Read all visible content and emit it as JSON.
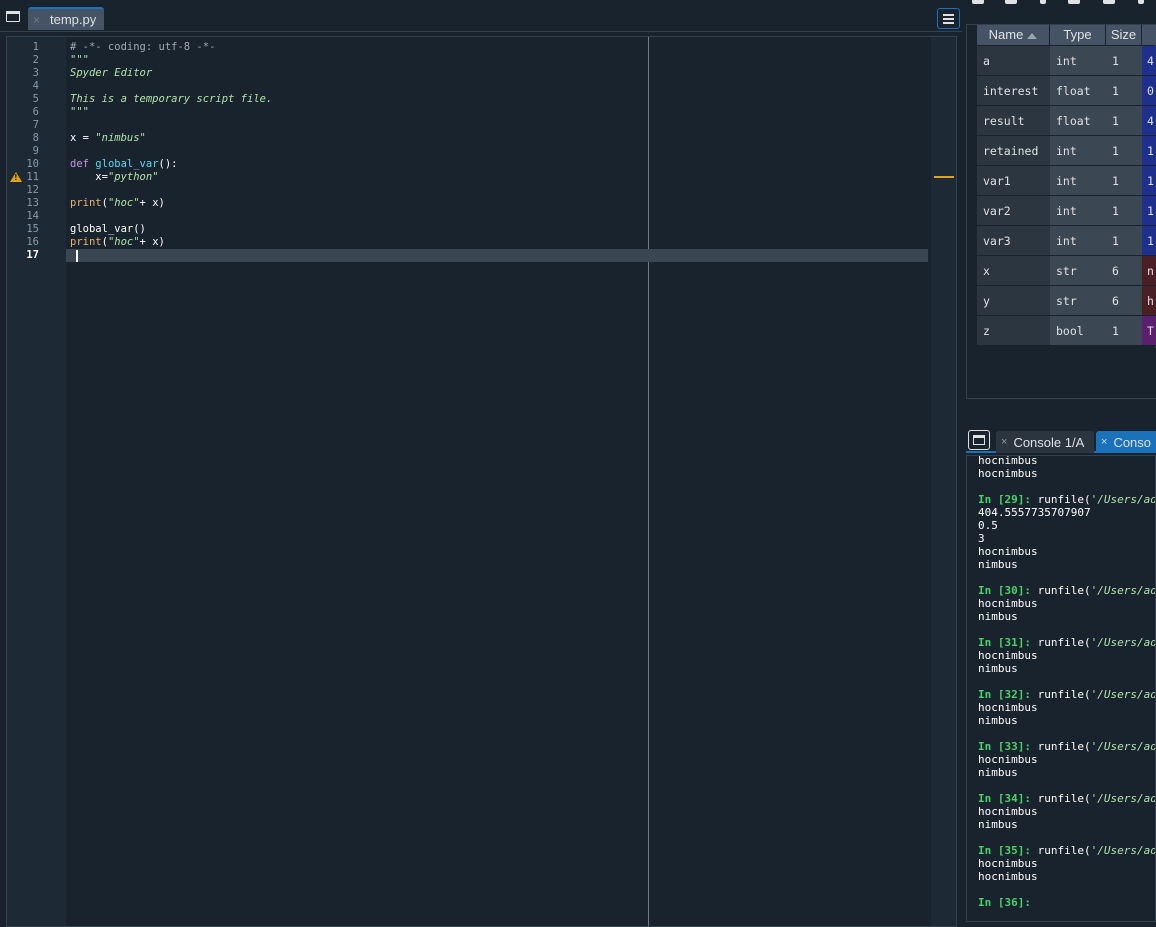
{
  "editor": {
    "tab_label": "temp.py",
    "tab_close": "×",
    "current_line": "17",
    "warning_line": "11",
    "lines": [
      {
        "num": "1",
        "parts": [
          {
            "t": "# -*- coding: utf-8 -*-",
            "c": "comment"
          }
        ]
      },
      {
        "num": "2",
        "parts": [
          {
            "t": "\"\"\"",
            "c": "string"
          }
        ]
      },
      {
        "num": "3",
        "parts": [
          {
            "t": "Spyder Editor",
            "c": "string"
          }
        ]
      },
      {
        "num": "4",
        "parts": []
      },
      {
        "num": "5",
        "parts": [
          {
            "t": "This is a temporary script file.",
            "c": "string"
          }
        ]
      },
      {
        "num": "6",
        "parts": [
          {
            "t": "\"\"\"",
            "c": "string"
          }
        ]
      },
      {
        "num": "7",
        "parts": []
      },
      {
        "num": "8",
        "parts": [
          {
            "t": "x = ",
            "c": "plain"
          },
          {
            "t": "\"nimbus\"",
            "c": "string"
          }
        ]
      },
      {
        "num": "9",
        "parts": []
      },
      {
        "num": "10",
        "parts": [
          {
            "t": "def ",
            "c": "kw"
          },
          {
            "t": "global_var",
            "c": "def"
          },
          {
            "t": "():",
            "c": "plain"
          }
        ]
      },
      {
        "num": "11",
        "parts": [
          {
            "t": "    x=",
            "c": "plain"
          },
          {
            "t": "\"python\"",
            "c": "string"
          }
        ]
      },
      {
        "num": "12",
        "parts": []
      },
      {
        "num": "13",
        "parts": [
          {
            "t": "print",
            "c": "builtin"
          },
          {
            "t": "(",
            "c": "plain"
          },
          {
            "t": "\"hoc\"",
            "c": "string"
          },
          {
            "t": "+ x)",
            "c": "plain"
          }
        ]
      },
      {
        "num": "14",
        "parts": []
      },
      {
        "num": "15",
        "parts": [
          {
            "t": "global_var()",
            "c": "plain"
          }
        ]
      },
      {
        "num": "16",
        "parts": [
          {
            "t": "print",
            "c": "builtin"
          },
          {
            "t": "(",
            "c": "plain"
          },
          {
            "t": "\"hoc\"",
            "c": "string"
          },
          {
            "t": "+ x)",
            "c": "plain"
          }
        ]
      },
      {
        "num": "17",
        "parts": []
      }
    ]
  },
  "variable_explorer": {
    "headers": {
      "name": "Name",
      "type": "Type",
      "size": "Size"
    },
    "rows": [
      {
        "name": "a",
        "type": "int",
        "size": "1",
        "value": "4",
        "color": "#1f2f8c"
      },
      {
        "name": "interest",
        "type": "float",
        "size": "1",
        "value": "0",
        "color": "#1f2f8c"
      },
      {
        "name": "result",
        "type": "float",
        "size": "1",
        "value": "4",
        "color": "#1f2f8c"
      },
      {
        "name": "retained",
        "type": "int",
        "size": "1",
        "value": "1",
        "color": "#1f2f8c"
      },
      {
        "name": "var1",
        "type": "int",
        "size": "1",
        "value": "1",
        "color": "#1f2f8c"
      },
      {
        "name": "var2",
        "type": "int",
        "size": "1",
        "value": "1",
        "color": "#1f2f8c"
      },
      {
        "name": "var3",
        "type": "int",
        "size": "1",
        "value": "1",
        "color": "#1f2f8c"
      },
      {
        "name": "x",
        "type": "str",
        "size": "6",
        "value": "n",
        "color": "#4a2025"
      },
      {
        "name": "y",
        "type": "str",
        "size": "6",
        "value": "h",
        "color": "#4a2025"
      },
      {
        "name": "z",
        "type": "bool",
        "size": "1",
        "value": "T",
        "color": "#5a1f6e"
      }
    ]
  },
  "console": {
    "tabs": [
      {
        "label": "Console 1/A",
        "close": "×"
      },
      {
        "label": "Conso",
        "close": "×"
      }
    ],
    "lines": [
      {
        "kind": "out",
        "text": "hocnimbus"
      },
      {
        "kind": "out",
        "text": "hocnimbus"
      },
      {
        "kind": "blank",
        "text": ""
      },
      {
        "kind": "in",
        "prompt": "In [29]:",
        "code": " runfile(",
        "path": "'/Users/ad"
      },
      {
        "kind": "out",
        "text": "404.5557735707907"
      },
      {
        "kind": "out",
        "text": "0.5"
      },
      {
        "kind": "out",
        "text": "3"
      },
      {
        "kind": "out",
        "text": "hocnimbus"
      },
      {
        "kind": "out",
        "text": "nimbus"
      },
      {
        "kind": "blank",
        "text": ""
      },
      {
        "kind": "in",
        "prompt": "In [30]:",
        "code": " runfile(",
        "path": "'/Users/ad"
      },
      {
        "kind": "out",
        "text": "hocnimbus"
      },
      {
        "kind": "out",
        "text": "nimbus"
      },
      {
        "kind": "blank",
        "text": ""
      },
      {
        "kind": "in",
        "prompt": "In [31]:",
        "code": " runfile(",
        "path": "'/Users/ad"
      },
      {
        "kind": "out",
        "text": "hocnimbus"
      },
      {
        "kind": "out",
        "text": "nimbus"
      },
      {
        "kind": "blank",
        "text": ""
      },
      {
        "kind": "in",
        "prompt": "In [32]:",
        "code": " runfile(",
        "path": "'/Users/ad"
      },
      {
        "kind": "out",
        "text": "hocnimbus"
      },
      {
        "kind": "out",
        "text": "nimbus"
      },
      {
        "kind": "blank",
        "text": ""
      },
      {
        "kind": "in",
        "prompt": "In [33]:",
        "code": " runfile(",
        "path": "'/Users/ad"
      },
      {
        "kind": "out",
        "text": "hocnimbus"
      },
      {
        "kind": "out",
        "text": "nimbus"
      },
      {
        "kind": "blank",
        "text": ""
      },
      {
        "kind": "in",
        "prompt": "In [34]:",
        "code": " runfile(",
        "path": "'/Users/ad"
      },
      {
        "kind": "out",
        "text": "hocnimbus"
      },
      {
        "kind": "out",
        "text": "nimbus"
      },
      {
        "kind": "blank",
        "text": ""
      },
      {
        "kind": "in",
        "prompt": "In [35]:",
        "code": " runfile(",
        "path": "'/Users/ad"
      },
      {
        "kind": "out",
        "text": "hocnimbus"
      },
      {
        "kind": "out",
        "text": "hocnimbus"
      },
      {
        "kind": "blank",
        "text": ""
      },
      {
        "kind": "in",
        "prompt": "In [36]:",
        "code": "",
        "path": ""
      }
    ]
  },
  "colors": {
    "background": "#19232d",
    "accent": "#1a72bb",
    "warning": "#e5a50a",
    "prompt": "#49d26a"
  }
}
